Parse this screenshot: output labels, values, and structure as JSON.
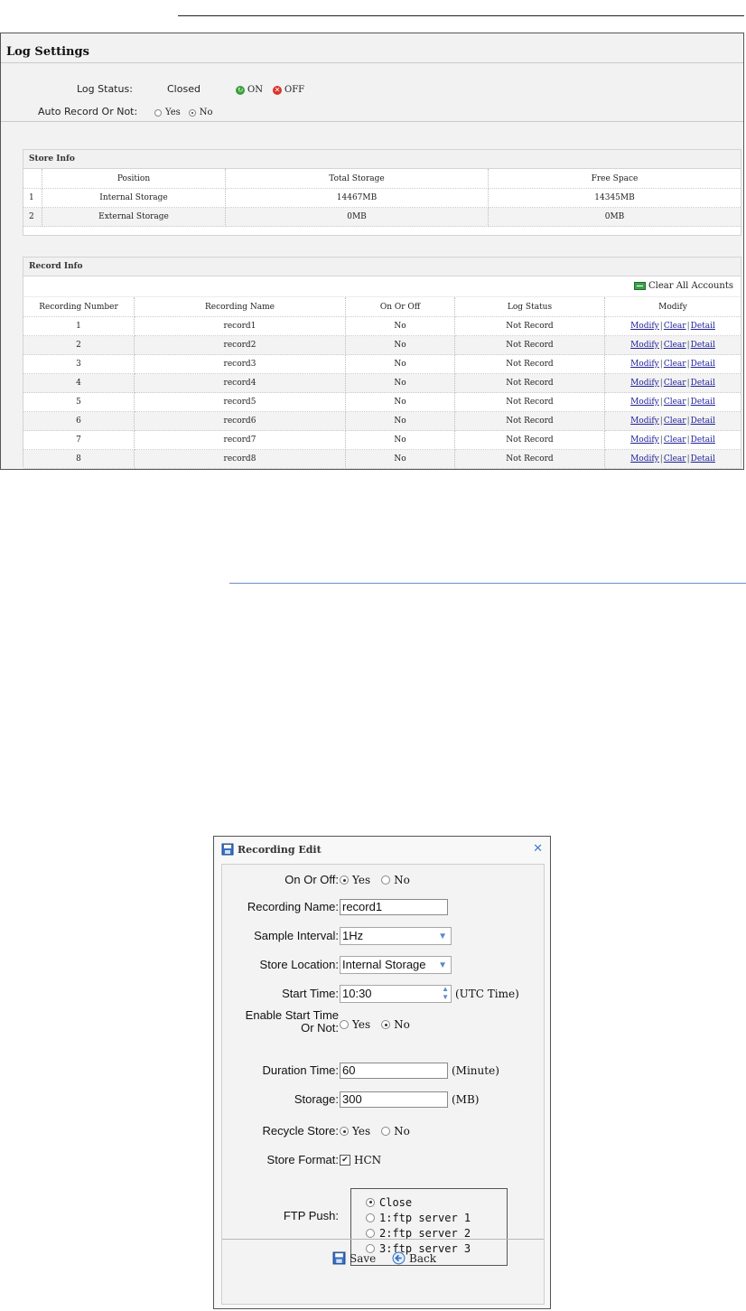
{
  "log_settings": {
    "title": "Log Settings",
    "log_status_label": "Log Status:",
    "log_status_value": "Closed",
    "on_label": "ON",
    "off_label": "OFF",
    "auto_record_label": "Auto Record Or Not:",
    "auto_record_options": [
      "Yes",
      "No"
    ],
    "auto_record_selected": "No"
  },
  "store_info": {
    "title": "Store Info",
    "columns": [
      "Position",
      "Total Storage",
      "Free Space"
    ],
    "rows": [
      {
        "index": "1",
        "position": "Internal Storage",
        "total": "14467MB",
        "free": "14345MB"
      },
      {
        "index": "2",
        "position": "External Storage",
        "total": "0MB",
        "free": "0MB"
      }
    ]
  },
  "record_info": {
    "title": "Record Info",
    "clear_all_label": "Clear All Accounts",
    "columns": [
      "Recording Number",
      "Recording Name",
      "On Or Off",
      "Log Status",
      "Modify"
    ],
    "actions": [
      "Modify",
      "Clear",
      "Detail"
    ],
    "rows": [
      {
        "number": "1",
        "name": "record1",
        "on_off": "No",
        "status": "Not Record"
      },
      {
        "number": "2",
        "name": "record2",
        "on_off": "No",
        "status": "Not Record"
      },
      {
        "number": "3",
        "name": "record3",
        "on_off": "No",
        "status": "Not Record"
      },
      {
        "number": "4",
        "name": "record4",
        "on_off": "No",
        "status": "Not Record"
      },
      {
        "number": "5",
        "name": "record5",
        "on_off": "No",
        "status": "Not Record"
      },
      {
        "number": "6",
        "name": "record6",
        "on_off": "No",
        "status": "Not Record"
      },
      {
        "number": "7",
        "name": "record7",
        "on_off": "No",
        "status": "Not Record"
      },
      {
        "number": "8",
        "name": "record8",
        "on_off": "No",
        "status": "Not Record"
      }
    ]
  },
  "dialog": {
    "title": "Recording Edit",
    "on_off_label": "On Or Off:",
    "yes": "Yes",
    "no": "No",
    "recording_name_label": "Recording Name:",
    "recording_name_value": "record1",
    "sample_interval_label": "Sample Interval:",
    "sample_interval_value": "1Hz",
    "store_location_label": "Store Location:",
    "store_location_value": "Internal Storage",
    "start_time_label": "Start Time:",
    "start_time_value": "10:30",
    "start_time_unit": "(UTC Time)",
    "enable_start_label_1": "Enable Start Time",
    "enable_start_label_2": "Or Not:",
    "duration_label": "Duration Time:",
    "duration_value": "60",
    "duration_unit": "(Minute)",
    "storage_label": "Storage:",
    "storage_value": "300",
    "storage_unit": "(MB)",
    "recycle_label": "Recycle Store:",
    "store_format_label": "Store Format:",
    "store_format_value": "HCN",
    "ftp_push_label": "FTP Push:",
    "ftp_options": [
      "Close",
      "1:ftp server 1",
      "2:ftp server 2",
      "3:ftp server 3"
    ],
    "save_label": "Save",
    "back_label": "Back"
  }
}
